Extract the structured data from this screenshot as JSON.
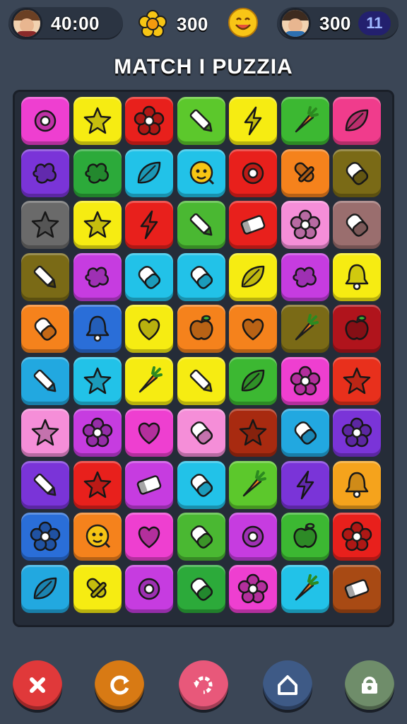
{
  "hud": {
    "left_value": "40:00",
    "coins": "300",
    "right_value": "300",
    "level": "11"
  },
  "title": "MATCH I PUZZIA",
  "colors": {
    "background": "#3b4656",
    "board": "#252c38",
    "close_button": "#e0393a",
    "shuffle_button": "#d87a14",
    "undo_button": "#e8587a",
    "home_button": "#3e5a86",
    "shop_button": "#6f8d6a"
  },
  "board": {
    "rows": [
      [
        {
          "c": "#ee3fd0",
          "i": "ring"
        },
        {
          "c": "#f6ec12",
          "i": "star"
        },
        {
          "c": "#e8201c",
          "i": "flower"
        },
        {
          "c": "#5cc82c",
          "i": "pencil"
        },
        {
          "c": "#f6ec12",
          "i": "bolt"
        },
        {
          "c": "#3cb832",
          "i": "carrot"
        },
        {
          "c": "#f03c8c",
          "i": "leaf"
        }
      ],
      [
        {
          "c": "#7a34d8",
          "i": "blob"
        },
        {
          "c": "#2caa3a",
          "i": "blob"
        },
        {
          "c": "#22c2e8",
          "i": "leaf"
        },
        {
          "c": "#22c2e8",
          "i": "face"
        },
        {
          "c": "#e8201c",
          "i": "ring"
        },
        {
          "c": "#f5821c",
          "i": "rocket"
        },
        {
          "c": "#7a6a16",
          "i": "pill"
        }
      ],
      [
        {
          "c": "#6a6a6a",
          "i": "star"
        },
        {
          "c": "#f6ec12",
          "i": "star"
        },
        {
          "c": "#e8201c",
          "i": "bolt"
        },
        {
          "c": "#4ab832",
          "i": "pencil"
        },
        {
          "c": "#e8201c",
          "i": "eraser"
        },
        {
          "c": "#f58ed8",
          "i": "flower"
        },
        {
          "c": "#9a6e6e",
          "i": "pill"
        }
      ],
      [
        {
          "c": "#7a6a16",
          "i": "pencil"
        },
        {
          "c": "#c63ce0",
          "i": "blob"
        },
        {
          "c": "#22c2e8",
          "i": "pill"
        },
        {
          "c": "#22c2e8",
          "i": "pill"
        },
        {
          "c": "#f6ec12",
          "i": "leaf"
        },
        {
          "c": "#c63ce0",
          "i": "blob"
        },
        {
          "c": "#f6ec12",
          "i": "bell"
        }
      ],
      [
        {
          "c": "#f5821c",
          "i": "pill"
        },
        {
          "c": "#2a6ed8",
          "i": "bell"
        },
        {
          "c": "#f6ec12",
          "i": "heart"
        },
        {
          "c": "#f5821c",
          "i": "apple"
        },
        {
          "c": "#f5821c",
          "i": "heart"
        },
        {
          "c": "#7a6a16",
          "i": "carrot"
        },
        {
          "c": "#b0141c",
          "i": "apple"
        }
      ],
      [
        {
          "c": "#22a8e0",
          "i": "pencil"
        },
        {
          "c": "#22c2e8",
          "i": "star"
        },
        {
          "c": "#f6ec12",
          "i": "carrot"
        },
        {
          "c": "#f6ec12",
          "i": "pencil"
        },
        {
          "c": "#3cb832",
          "i": "leaf"
        },
        {
          "c": "#ee3fd0",
          "i": "flower"
        },
        {
          "c": "#e8301c",
          "i": "star"
        }
      ],
      [
        {
          "c": "#f58ed8",
          "i": "star"
        },
        {
          "c": "#c63ce0",
          "i": "flower"
        },
        {
          "c": "#ee3fd0",
          "i": "heart"
        },
        {
          "c": "#f58ed8",
          "i": "pill"
        },
        {
          "c": "#a82a10",
          "i": "star"
        },
        {
          "c": "#22a8e0",
          "i": "pill"
        },
        {
          "c": "#7a34d8",
          "i": "flower"
        }
      ],
      [
        {
          "c": "#7a34d8",
          "i": "pencil"
        },
        {
          "c": "#e8201c",
          "i": "star"
        },
        {
          "c": "#c63ce0",
          "i": "eraser"
        },
        {
          "c": "#22c2e8",
          "i": "pill"
        },
        {
          "c": "#5cc82c",
          "i": "carrot"
        },
        {
          "c": "#7a34d8",
          "i": "bolt"
        },
        {
          "c": "#f5a31c",
          "i": "bell"
        }
      ],
      [
        {
          "c": "#2a6ed8",
          "i": "flower"
        },
        {
          "c": "#f5821c",
          "i": "face"
        },
        {
          "c": "#ee3fd0",
          "i": "heart"
        },
        {
          "c": "#4ab832",
          "i": "pill"
        },
        {
          "c": "#c63ce0",
          "i": "ring"
        },
        {
          "c": "#3cb832",
          "i": "apple"
        },
        {
          "c": "#e8201c",
          "i": "flower"
        }
      ],
      [
        {
          "c": "#22a8e0",
          "i": "leaf"
        },
        {
          "c": "#f6ec12",
          "i": "rocket"
        },
        {
          "c": "#c63ce0",
          "i": "ring"
        },
        {
          "c": "#2caa3a",
          "i": "pill"
        },
        {
          "c": "#ee3fd0",
          "i": "flower"
        },
        {
          "c": "#22c2e8",
          "i": "carrot"
        },
        {
          "c": "#a84a14",
          "i": "eraser"
        }
      ]
    ]
  },
  "buttons": [
    {
      "name": "close-button",
      "icon": "close-icon"
    },
    {
      "name": "shuffle-button",
      "icon": "shuffle-icon"
    },
    {
      "name": "undo-button",
      "icon": "undo-icon"
    },
    {
      "name": "home-button",
      "icon": "home-icon"
    },
    {
      "name": "shop-button",
      "icon": "shop-icon"
    }
  ]
}
